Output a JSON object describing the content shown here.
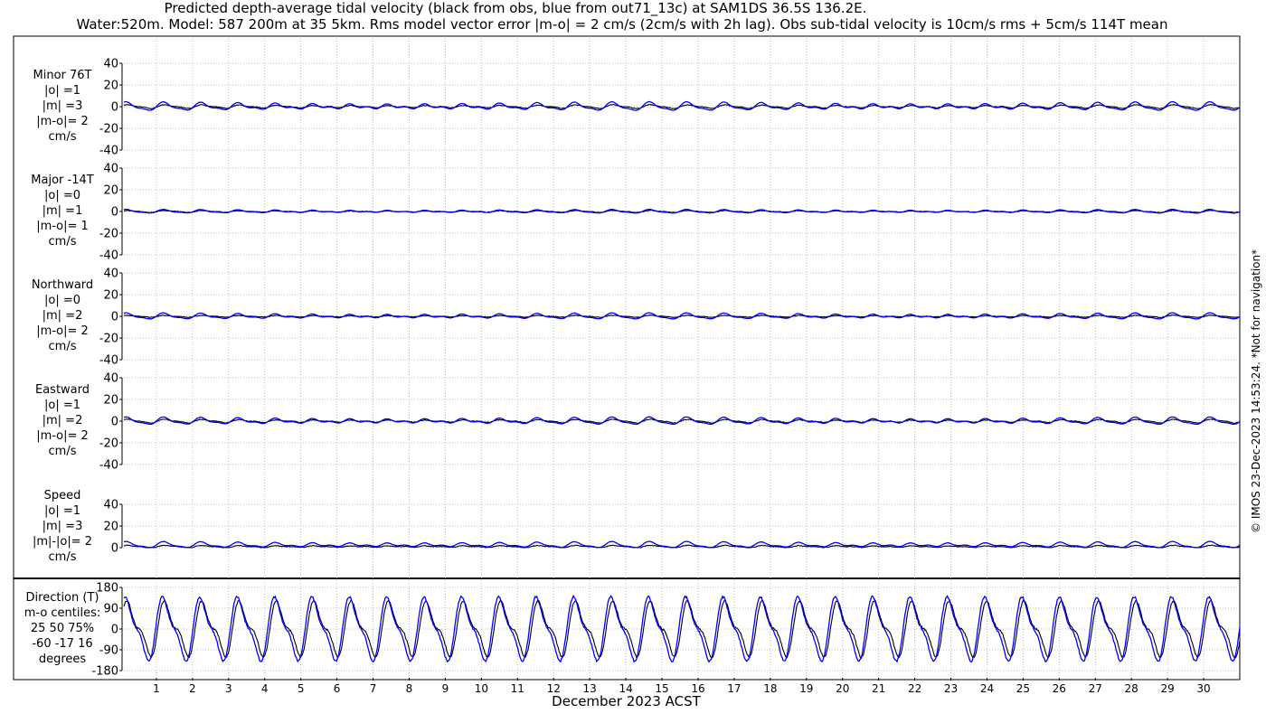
{
  "title_line1": "Predicted depth-average tidal velocity (black from obs, blue from out71_13c) at SAM1DS 36.5S 136.2E.",
  "title_line2": "Water:520m. Model: 587 200m at 35 5km. Rms model vector error |m-o| = 2 cm/s (2cm/s with 2h lag). Obs sub-tidal velocity is 10cm/s rms + 5cm/s 114T mean",
  "credit": "© IMOS 23-Dec-2023 14:53:24. *Not for navigation*",
  "colors": {
    "obs": "#000000",
    "model": "#0000ff",
    "grid": "#b0b0b0"
  },
  "panels": [
    {
      "id": "minor",
      "lines": [
        "Minor 76T",
        "|o| =1",
        "|m| =3",
        "|m-o|= 2",
        "cm/s"
      ]
    },
    {
      "id": "major",
      "lines": [
        "Major -14T",
        "|o| =0",
        "|m| =1",
        "|m-o|= 1",
        "cm/s"
      ]
    },
    {
      "id": "north",
      "lines": [
        "Northward",
        "|o| =0",
        "|m| =2",
        "|m-o|= 2",
        "cm/s"
      ]
    },
    {
      "id": "east",
      "lines": [
        "Eastward",
        "|o| =1",
        "|m| =2",
        "|m-o|= 2",
        "cm/s"
      ]
    },
    {
      "id": "speed",
      "lines": [
        "Speed",
        "|o| =1",
        "|m| =3",
        "|m|-|o|= 2",
        "cm/s"
      ]
    },
    {
      "id": "dir",
      "lines": [
        "Direction (T)",
        "m-o centiles:",
        "25  50  75%",
        "-60 -17  16",
        "degrees"
      ]
    }
  ],
  "xlabel": "December 2023 ACST",
  "chart_data": {
    "type": "line",
    "x_unit": "day of December 2023",
    "xlim": [
      0.1,
      31.0
    ],
    "x_ticks": [
      1,
      2,
      3,
      4,
      5,
      6,
      7,
      8,
      9,
      10,
      11,
      12,
      13,
      14,
      15,
      16,
      17,
      18,
      19,
      20,
      21,
      22,
      23,
      24,
      25,
      26,
      27,
      28,
      29,
      30
    ],
    "series_names": [
      "obs",
      "model"
    ],
    "panels": [
      {
        "name": "Minor 76T",
        "ylim": [
          -40,
          40
        ],
        "yticks": [
          -40,
          -20,
          0,
          20,
          40
        ],
        "obs": {
          "amp": 1.5,
          "mean": 0
        },
        "model": {
          "amp": 3.5,
          "mean": 0
        }
      },
      {
        "name": "Major -14T",
        "ylim": [
          -40,
          40
        ],
        "yticks": [
          -40,
          -20,
          0,
          20,
          40
        ],
        "obs": {
          "amp": 0.8,
          "mean": 0
        },
        "model": {
          "amp": 1.5,
          "mean": 0
        }
      },
      {
        "name": "Northward",
        "ylim": [
          -40,
          40
        ],
        "yticks": [
          -40,
          -20,
          0,
          20,
          40
        ],
        "obs": {
          "amp": 0.8,
          "mean": 0
        },
        "model": {
          "amp": 2.5,
          "mean": 0
        }
      },
      {
        "name": "Eastward",
        "ylim": [
          -40,
          40
        ],
        "yticks": [
          -40,
          -20,
          0,
          20,
          40
        ],
        "obs": {
          "amp": 1.5,
          "mean": 0
        },
        "model": {
          "amp": 3.0,
          "mean": 0
        }
      },
      {
        "name": "Speed",
        "ylim": [
          0,
          40
        ],
        "yticks": [
          0,
          20,
          40
        ],
        "obs": {
          "amp": 1.0,
          "mean": 1.0
        },
        "model": {
          "amp": 2.5,
          "mean": 2.5
        }
      },
      {
        "name": "Direction (T)",
        "ylim": [
          -180,
          180
        ],
        "yticks": [
          -180,
          -90,
          0,
          90,
          180
        ],
        "obs": {
          "amp": 100,
          "mean": 0
        },
        "model": {
          "amp": 120,
          "mean": 0
        }
      }
    ]
  }
}
